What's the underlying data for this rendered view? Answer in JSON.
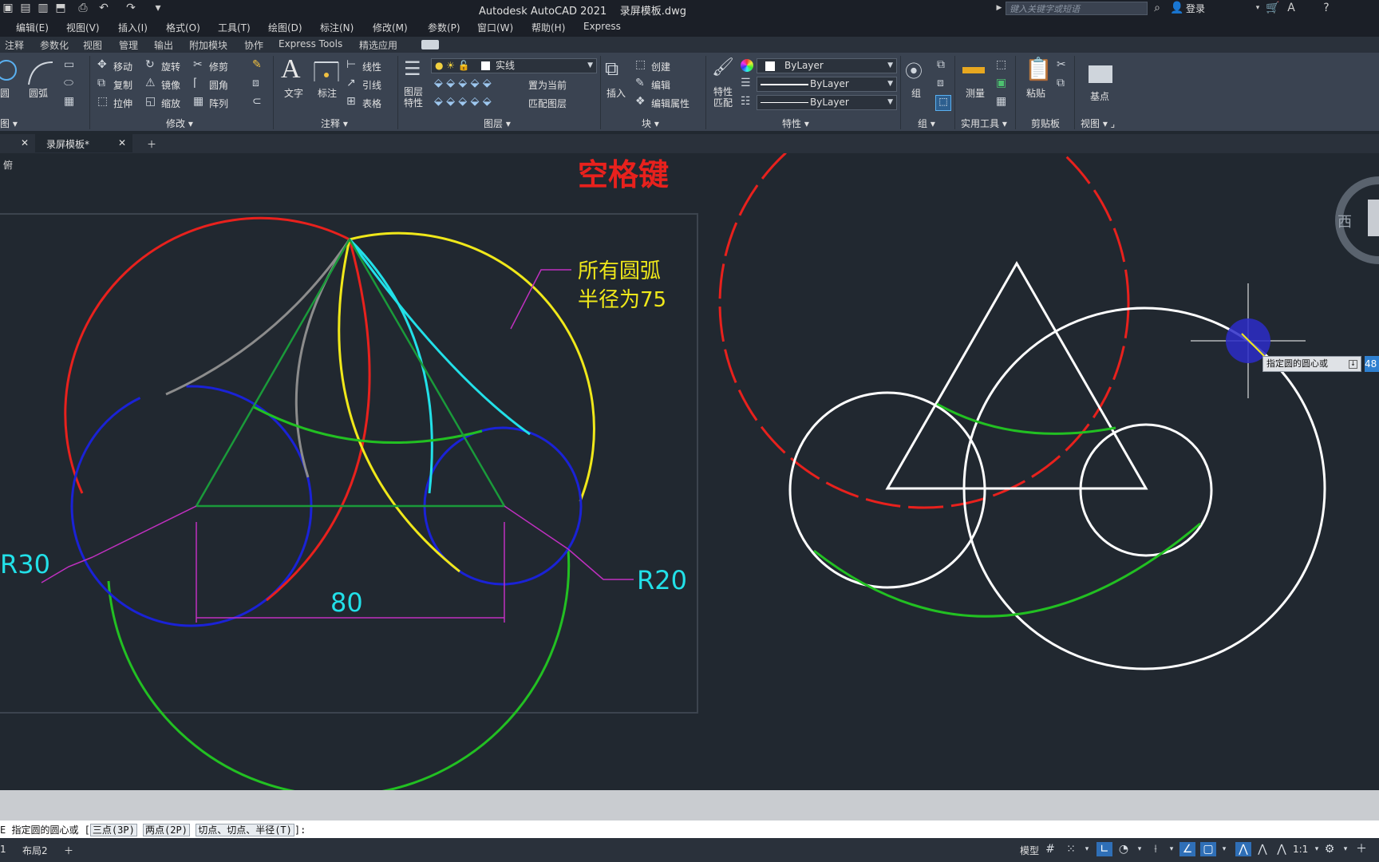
{
  "titlebar": {
    "app": "Autodesk AutoCAD 2021",
    "file": "录屏模板.dwg",
    "search_placeholder": "键入关键字或短语",
    "login": "登录"
  },
  "menu": [
    "编辑(E)",
    "视图(V)",
    "插入(I)",
    "格式(O)",
    "工具(T)",
    "绘图(D)",
    "标注(N)",
    "修改(M)",
    "参数(P)",
    "窗口(W)",
    "帮助(H)",
    "Express"
  ],
  "ribbon_tabs": [
    "注释",
    "参数化",
    "视图",
    "管理",
    "输出",
    "附加模块",
    "协作",
    "Express Tools",
    "精选应用"
  ],
  "ribbon": {
    "draw": {
      "circle": "圆",
      "arc": "圆弧",
      "title": "图"
    },
    "modify": {
      "move": "移动",
      "rotate": "旋转",
      "trim": "修剪",
      "copy": "复制",
      "mirror": "镜像",
      "fillet": "圆角",
      "stretch": "拉伸",
      "scale": "缩放",
      "array": "阵列",
      "title": "修改"
    },
    "annotation": {
      "text": "文字",
      "dim": "标注",
      "linear": "线性",
      "leader": "引线",
      "table": "表格",
      "title": "注释"
    },
    "layers": {
      "props": "图层\n特性",
      "layer_value": "实线",
      "set_current": "置为当前",
      "match_layer": "匹配图层",
      "title": "图层"
    },
    "block": {
      "insert": "插入",
      "create": "创建",
      "edit": "编辑",
      "edit_attr": "编辑属性",
      "title": "块"
    },
    "properties": {
      "match": "特性\n匹配",
      "color": "ByLayer",
      "linetype": "ByLayer",
      "lineweight": "ByLayer",
      "title": "特性"
    },
    "groups": {
      "group": "组",
      "title": "组"
    },
    "utilities": {
      "measure": "测量",
      "title": "实用工具"
    },
    "clipboard": {
      "paste": "粘贴",
      "title": "剪贴板"
    },
    "view": {
      "base": "基点",
      "title": "视图"
    }
  },
  "filetabs": {
    "active": "录屏模板*",
    "viewport_label": "俯"
  },
  "drawing": {
    "space_key": "空格键",
    "note_line1": "所有圆弧",
    "note_line2": "半径为75",
    "dim_r30": "R30",
    "dim_r20": "R20",
    "dim_80": "80",
    "viewcube_west": "西",
    "tooltip": "指定圆的圆心或",
    "coord_value": "48",
    "colors": {
      "red": "#e8211d",
      "blue": "#1a22d6",
      "green": "#22c022",
      "yellow": "#f0e81a",
      "cyan": "#22e0e8",
      "gray": "#8c8c8c",
      "dkgreen": "#1a9a3a",
      "magenta": "#c030c0",
      "white": "#ffffff"
    }
  },
  "command": {
    "prefix": "E 指定圆的圆心或 [",
    "opt1": "三点(3P)",
    "opt2": "两点(2P)",
    "opt3": "切点、切点、半径(T)",
    "suffix": "]:"
  },
  "statusbar": {
    "layout_tab": "布局2",
    "model": "模型",
    "scale": "1:1"
  }
}
